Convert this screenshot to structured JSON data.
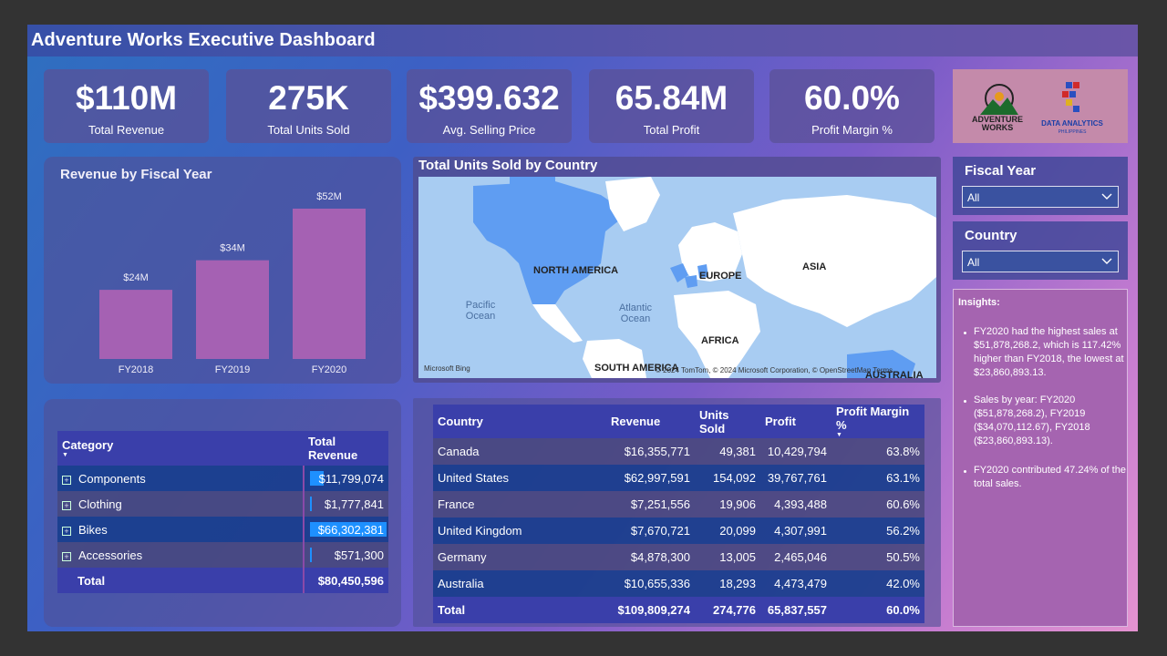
{
  "title": "Adventure Works Executive Dashboard",
  "kpis": [
    {
      "value": "$110M",
      "label": "Total Revenue"
    },
    {
      "value": "275K",
      "label": "Total Units Sold"
    },
    {
      "value": "$399.632",
      "label": "Avg. Selling Price"
    },
    {
      "value": "65.84M",
      "label": "Total Profit"
    },
    {
      "value": "60.0%",
      "label": "Profit Margin %"
    }
  ],
  "logos": {
    "adventure_works": "ADVENTURE WORKS",
    "dap_letters": "DAP",
    "data_analytics": "DATA ANALYTICS",
    "philippines": "PHILIPPINES"
  },
  "colors": {
    "bar": "#a561b3",
    "accent": "#3a3faa",
    "databar": "#1e90ff"
  },
  "chart_data": {
    "type": "bar",
    "title": "Revenue by Fiscal Year",
    "categories": [
      "FY2018",
      "FY2019",
      "FY2020"
    ],
    "values": [
      23860893.13,
      34070112.67,
      51878268.2
    ],
    "data_labels": [
      "$24M",
      "$34M",
      "$52M"
    ],
    "grid": false
  },
  "map": {
    "title": "Total Units Sold by Country",
    "labels": {
      "north_america": "NORTH AMERICA",
      "europe": "EUROPE",
      "asia": "ASIA",
      "africa": "AFRICA",
      "south_america": "SOUTH AMERICA",
      "australia": "AUSTRALIA",
      "pacific": "Pacific Ocean",
      "atlantic": "Atlantic Ocean"
    },
    "bing": "Microsoft Bing",
    "attribution": "© 2024 TomTom, © 2024 Microsoft Corporation, © OpenStreetMap  Terms"
  },
  "slicers": [
    {
      "title": "Fiscal Year",
      "value": "All"
    },
    {
      "title": "Country",
      "value": "All"
    }
  ],
  "insights": {
    "heading": "Insights:",
    "items": [
      "FY2020 had the highest sales at $51,878,268.2, which is 117.42% higher than FY2018, the lowest at $23,860,893.13.",
      "Sales by year: FY2020 ($51,878,268.2), FY2019 ($34,070,112.67), FY2018 ($23,860,893.13).",
      "FY2020 contributed 47.24% of the total sales."
    ]
  },
  "category_table": {
    "headers": [
      "Category",
      "Total Revenue"
    ],
    "rows": [
      {
        "category": "Components",
        "revenue": "$11,799,074",
        "share": 0.178
      },
      {
        "category": "Clothing",
        "revenue": "$1,777,841",
        "share": 0.027
      },
      {
        "category": "Bikes",
        "revenue": "$66,302,381",
        "share": 1.0
      },
      {
        "category": "Accessories",
        "revenue": "$571,300",
        "share": 0.009
      }
    ],
    "total": {
      "label": "Total",
      "revenue": "$80,450,596"
    }
  },
  "country_table": {
    "headers": [
      "Country",
      "Revenue",
      "Units Sold",
      "Profit",
      "Profit Margin %"
    ],
    "rows": [
      [
        "Canada",
        "$16,355,771",
        "49,381",
        "10,429,794",
        "63.8%"
      ],
      [
        "United States",
        "$62,997,591",
        "154,092",
        "39,767,761",
        "63.1%"
      ],
      [
        "France",
        "$7,251,556",
        "19,906",
        "4,393,488",
        "60.6%"
      ],
      [
        "United Kingdom",
        "$7,670,721",
        "20,099",
        "4,307,991",
        "56.2%"
      ],
      [
        "Germany",
        "$4,878,300",
        "13,005",
        "2,465,046",
        "50.5%"
      ],
      [
        "Australia",
        "$10,655,336",
        "18,293",
        "4,473,479",
        "42.0%"
      ]
    ],
    "total": [
      "Total",
      "$109,809,274",
      "274,776",
      "65,837,557",
      "60.0%"
    ]
  }
}
